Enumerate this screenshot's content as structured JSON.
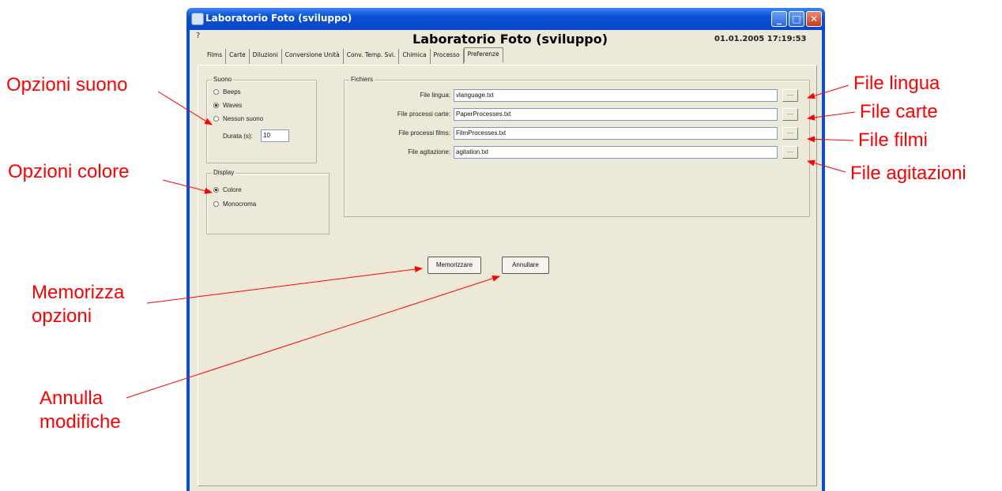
{
  "window": {
    "title": "Laboratorio Foto (sviluppo)",
    "controls": {
      "minimize": "_",
      "maximize": "□",
      "close": "✕"
    }
  },
  "menu": {
    "help": "?"
  },
  "header": {
    "app_title": "Laboratorio Foto (sviluppo)",
    "datetime": "01.01.2005 17:19:53"
  },
  "tabs": [
    {
      "label": "Films"
    },
    {
      "label": "Carte"
    },
    {
      "label": "Diluzioni"
    },
    {
      "label": "Conversione Unità"
    },
    {
      "label": "Conv. Temp. Svi."
    },
    {
      "label": "Chimica"
    },
    {
      "label": "Processo"
    },
    {
      "label": "Preferenze",
      "active": true
    }
  ],
  "sound_group": {
    "title": "Suono",
    "options": [
      {
        "label": "Beeps",
        "selected": false
      },
      {
        "label": "Waves",
        "selected": true
      },
      {
        "label": "Nessun suono",
        "selected": false
      }
    ],
    "duration_label": "Durata (s):",
    "duration_value": "10"
  },
  "display_group": {
    "title": "Display",
    "options": [
      {
        "label": "Colore",
        "selected": true
      },
      {
        "label": "Monocroma",
        "selected": false
      }
    ]
  },
  "files_group": {
    "title": "Fichiers",
    "rows": [
      {
        "label": "File lingua:",
        "value": "vlanguage.txt",
        "browse": "..."
      },
      {
        "label": "File processi carte:",
        "value": "PaperProcesses.txt",
        "browse": "..."
      },
      {
        "label": "File processi films:",
        "value": "FilmProcesses.txt",
        "browse": "..."
      },
      {
        "label": "File agitazione:",
        "value": "agitation.txt",
        "browse": "..."
      }
    ]
  },
  "buttons": {
    "save": "Memorizzare",
    "cancel": "Annullare"
  },
  "annotations": {
    "sound_options": "Opzioni suono",
    "color_options": "Opzioni colore",
    "save_options": [
      "Memorizza",
      "opzioni"
    ],
    "cancel_changes": [
      "Annulla",
      "modifiche"
    ],
    "file_language": "File lingua",
    "file_papers": "File carte",
    "file_films": "File filmi",
    "file_agitation": "File agitazioni"
  },
  "colors": {
    "annotation": "#ff0000",
    "window_frame": "#0a4fd6",
    "client_bg": "#ece9d8"
  }
}
